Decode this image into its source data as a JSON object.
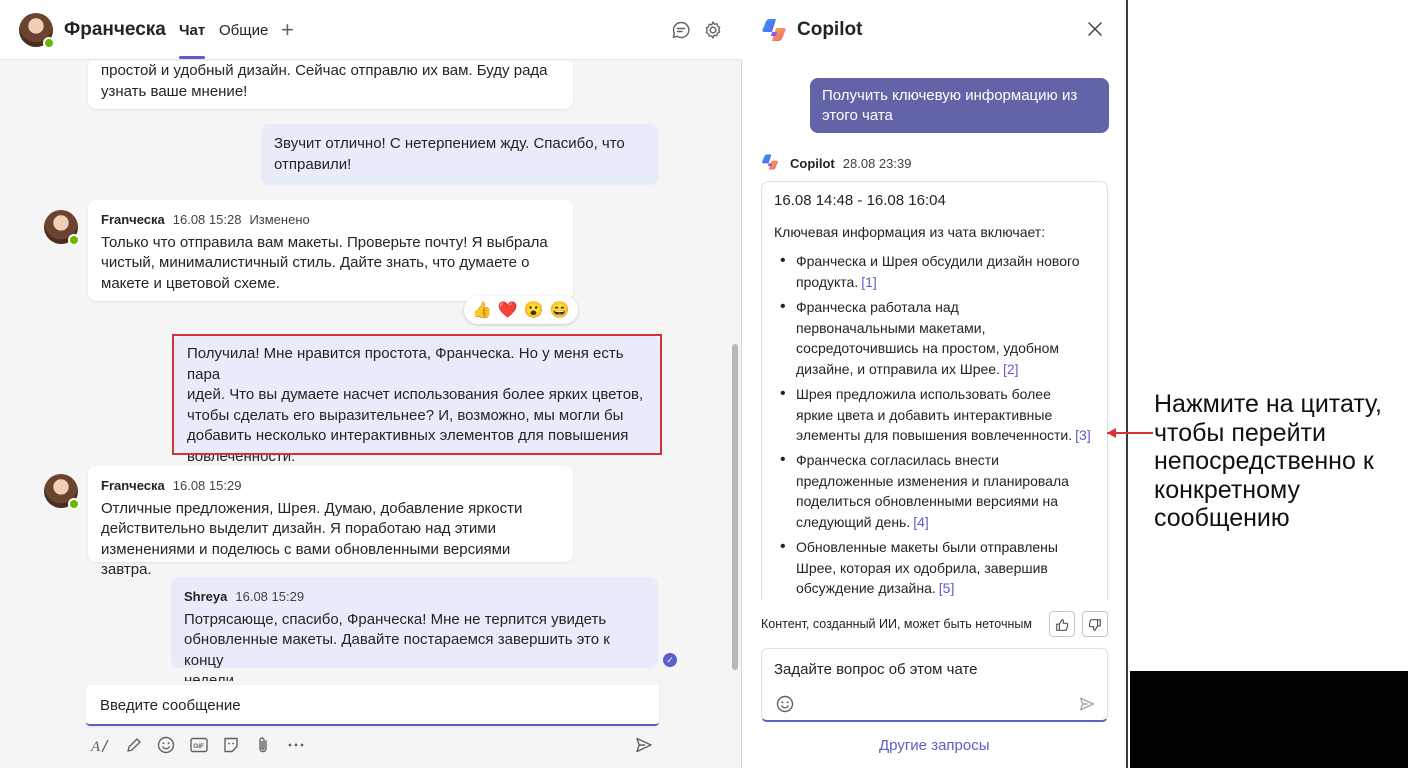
{
  "chat": {
    "contact_name": "Франческа",
    "tabs": [
      {
        "label": "Чат"
      },
      {
        "label": "Общие"
      }
    ],
    "add_tab_label": "+",
    "messages": [
      {
        "lines": [
          "простой и удобный дизайн. Сейчас отправлю их вам. Буду рада",
          "узнать ваше мнение!"
        ]
      },
      {
        "lines": [
          "Звучит отлично! С нетерпением жду. Спасибо, что",
          "отправили!"
        ]
      },
      {
        "sender": "Franческа",
        "time": "16.08 15:28",
        "edited": "Изменено",
        "lines": [
          "Только что отправила вам макеты. Проверьте почту! Я выбрала",
          "чистый, минималистичный стиль. Дайте знать, что думаете о",
          "макете и цветовой схеме."
        ]
      },
      {
        "lines": [
          "Получила! Мне нравится простота, Франческа. Но у меня есть пара",
          "идей. Что вы думаете насчет использования более ярких цветов,",
          "чтобы сделать его выразительнее? И, возможно, мы могли бы",
          "добавить несколько интерактивных элементов для повышения",
          "вовлеченности."
        ]
      },
      {
        "sender": "Franческа",
        "time": "16.08 15:29",
        "lines": [
          "Отличные предложения, Шрея. Думаю, добавление яркости",
          "действительно выделит дизайн. Я поработаю над этими",
          "изменениями и поделюсь с вами обновленными версиями завтра."
        ]
      },
      {
        "sender": "Shreya",
        "time": "16.08 15:29",
        "lines": [
          "Потрясающе, спасибо, Франческа! Мне не терпится увидеть",
          "обновленные макеты. Давайте постараемся завершить это к концу",
          "недели."
        ]
      }
    ],
    "reactions": [
      "👍",
      "❤️",
      "😮",
      "😄"
    ],
    "composer_placeholder": "Введите сообщение",
    "toolbar_icons": [
      "format-icon",
      "pen-icon",
      "emoji-icon",
      "gif-icon",
      "sticker-icon",
      "attach-icon",
      "more-icon",
      "send-icon"
    ]
  },
  "copilot": {
    "title": "Copilot",
    "prompt": [
      "Получить ключевую информацию из",
      "этого чата"
    ],
    "response_author": "Copilot",
    "response_time": "28.08 23:39",
    "date_range": "16.08 14:48 - 16.08 16:04",
    "intro": "Ключевая информация из чата включает:",
    "items": [
      {
        "lines": [
          "Франческа и Шрея обсудили дизайн нового",
          "продукта."
        ],
        "cite": "[1]"
      },
      {
        "lines": [
          "Франческа работала над",
          "первоначальными макетами,",
          "сосредоточившись на простом, удобном",
          "дизайне, и отправила их Шрее."
        ],
        "cite": "[2]"
      },
      {
        "lines": [
          "Шрея предложила использовать более",
          "яркие цвета и добавить интерактивные",
          "элементы для повышения вовлеченности."
        ],
        "cite": "[3]"
      },
      {
        "lines": [
          "Франческа согласилась внести",
          "предложенные изменения и планировала",
          "поделиться обновленными версиями на",
          "следующий день."
        ],
        "cite": "[4]"
      },
      {
        "lines": [
          "Обновленные макеты были отправлены",
          "Шрее, которая их одобрила, завершив",
          "обсуждение дизайна."
        ],
        "cite": "[5]"
      }
    ],
    "disclaimer": "Контент, созданный ИИ, может быть неточным",
    "input_placeholder": "Задайте вопрос об этом чате",
    "more_prompts": "Другие запросы"
  },
  "annotation": {
    "lines": [
      "Нажмите на цитату,",
      "чтобы перейти",
      "непосредственно к",
      "конкретному",
      "сообщению"
    ]
  },
  "colors": {
    "accent": "#5b5fc7",
    "prompt_bubble": "#6264a7",
    "outgoing_bubble": "#e8ebfa",
    "highlight": "#d13438",
    "presence": "#6bb700"
  }
}
